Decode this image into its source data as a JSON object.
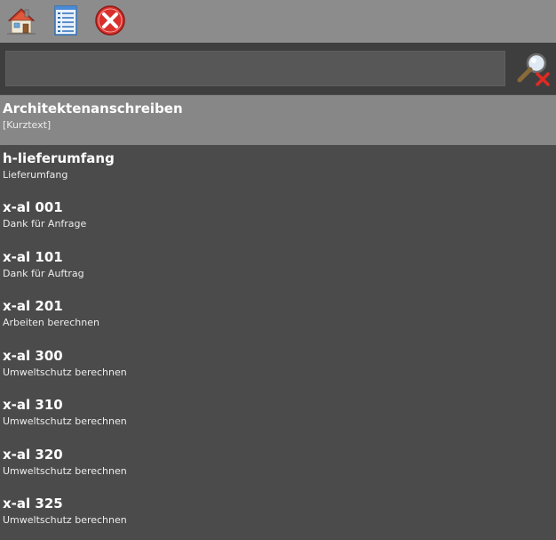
{
  "toolbar": {
    "buttons": [
      {
        "icon": "home-icon"
      },
      {
        "icon": "document-list-icon"
      },
      {
        "icon": "close-circle-icon"
      }
    ]
  },
  "search": {
    "value": "",
    "placeholder": "",
    "clear_icon": "search-clear-icon"
  },
  "colors": {
    "toolbar_bg": "#8c8c8c",
    "search_bar_bg": "#3e3e3e",
    "list_bg": "#4b4b4b",
    "selected_bg": "#878787",
    "close_red": "#d9302b"
  },
  "list": {
    "selected_index": 0,
    "items": [
      {
        "title": "Architektenanschreiben",
        "subtitle": "[Kurztext]"
      },
      {
        "title": "h-lieferumfang",
        "subtitle": "Lieferumfang"
      },
      {
        "title": "x-al 001",
        "subtitle": "Dank für Anfrage"
      },
      {
        "title": "x-al 101",
        "subtitle": "Dank für Auftrag"
      },
      {
        "title": "x-al 201",
        "subtitle": "Arbeiten berechnen"
      },
      {
        "title": "x-al 300",
        "subtitle": "Umweltschutz berechnen"
      },
      {
        "title": "x-al 310",
        "subtitle": "Umweltschutz berechnen"
      },
      {
        "title": "x-al 320",
        "subtitle": "Umweltschutz berechnen"
      },
      {
        "title": "x-al 325",
        "subtitle": "Umweltschutz berechnen"
      }
    ]
  }
}
